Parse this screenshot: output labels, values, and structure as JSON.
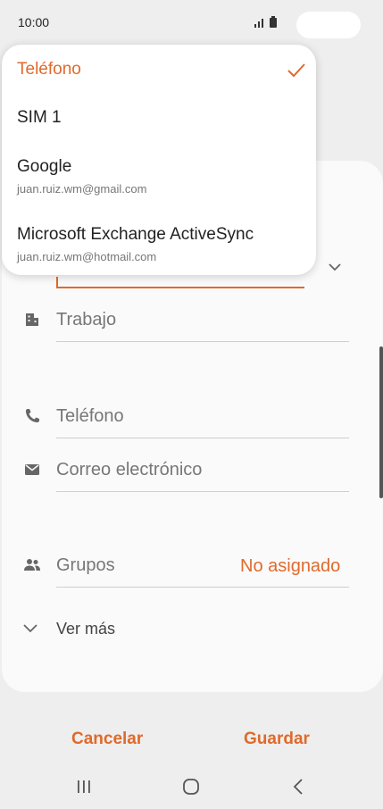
{
  "status_bar": {
    "time": "10:00",
    "signal_icon": "signal-icon",
    "battery_icon": "battery-icon"
  },
  "form": {
    "fields": [
      {
        "label": "Trabajo",
        "icon": "building-icon"
      },
      {
        "label": "Teléfono",
        "icon": "phone-icon"
      },
      {
        "label": "Correo electrónico",
        "icon": "envelope-icon"
      },
      {
        "label": "Grupos",
        "icon": "people-icon",
        "value": "No asignado"
      }
    ],
    "see_more_label": "Ver más"
  },
  "actions": {
    "cancel_label": "Cancelar",
    "save_label": "Guardar"
  },
  "storage_popup": {
    "options": [
      {
        "title": "Teléfono",
        "subtitle": "",
        "selected": true
      },
      {
        "title": "SIM 1",
        "subtitle": "",
        "selected": false
      },
      {
        "title": "Google",
        "subtitle": "juan.ruiz.wm@gmail.com",
        "selected": false
      },
      {
        "title": "Microsoft Exchange ActiveSync",
        "subtitle": "juan.ruiz.wm@hotmail.com",
        "selected": false
      }
    ]
  },
  "colors": {
    "accent": "#e06a2b",
    "background": "#eeeeee",
    "card": "#fafafa"
  }
}
